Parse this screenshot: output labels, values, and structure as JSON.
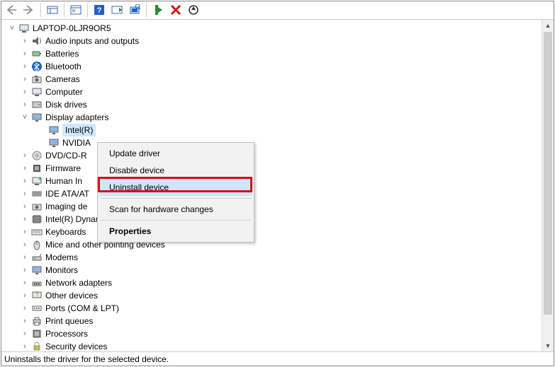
{
  "root": {
    "label": "LAPTOP-0LJR9OR5"
  },
  "categories": [
    {
      "id": "audio",
      "label": "Audio inputs and outputs",
      "exp": ">"
    },
    {
      "id": "batt",
      "label": "Batteries",
      "exp": ">"
    },
    {
      "id": "bt",
      "label": "Bluetooth",
      "exp": ">"
    },
    {
      "id": "cam",
      "label": "Cameras",
      "exp": ">"
    },
    {
      "id": "comp",
      "label": "Computer",
      "exp": ">"
    },
    {
      "id": "disk",
      "label": "Disk drives",
      "exp": ">"
    },
    {
      "id": "disp",
      "label": "Display adapters",
      "exp": "v",
      "children": [
        {
          "id": "disp-intel",
          "label": "Intel(R)",
          "selected": true
        },
        {
          "id": "disp-nvidia",
          "label": "NVIDIA"
        }
      ]
    },
    {
      "id": "dvd",
      "label": "DVD/CD-R",
      "exp": ">",
      "truncated": true
    },
    {
      "id": "fw",
      "label": "Firmware",
      "exp": ">",
      "truncated": true
    },
    {
      "id": "hid",
      "label": "Human In",
      "exp": ">",
      "truncated": true
    },
    {
      "id": "ide",
      "label": "IDE ATA/AT",
      "exp": ">",
      "truncated": true
    },
    {
      "id": "img",
      "label": "Imaging de",
      "exp": ">",
      "truncated": true
    },
    {
      "id": "dptf",
      "label": "Intel(R) Dynamic Platform and Thermal Framework",
      "exp": ">"
    },
    {
      "id": "kb",
      "label": "Keyboards",
      "exp": ">"
    },
    {
      "id": "mice",
      "label": "Mice and other pointing devices",
      "exp": ">"
    },
    {
      "id": "modem",
      "label": "Modems",
      "exp": ">"
    },
    {
      "id": "mon",
      "label": "Monitors",
      "exp": ">"
    },
    {
      "id": "net",
      "label": "Network adapters",
      "exp": ">"
    },
    {
      "id": "other",
      "label": "Other devices",
      "exp": ">"
    },
    {
      "id": "ports",
      "label": "Ports (COM & LPT)",
      "exp": ">"
    },
    {
      "id": "print",
      "label": "Print queues",
      "exp": ">"
    },
    {
      "id": "proc",
      "label": "Processors",
      "exp": ">"
    },
    {
      "id": "sec",
      "label": "Security devices",
      "exp": ">"
    }
  ],
  "context_menu": {
    "items": [
      {
        "label": "Update driver"
      },
      {
        "label": "Disable device"
      },
      {
        "label": "Uninstall device",
        "highlight": true,
        "hover": true
      },
      "sep",
      {
        "label": "Scan for hardware changes"
      },
      "sep",
      {
        "label": "Properties",
        "bold": true
      }
    ]
  },
  "status_bar": "Uninstalls the driver for the selected device.",
  "icons": {
    "computer": "🖥",
    "audio": "🔊",
    "battery": "🔋",
    "bt": "ᛒ",
    "camera": "📷",
    "disk": "🖴",
    "display": "🖵",
    "dvd": "💿",
    "fw": "▤",
    "hid": "🖐",
    "ide": "≣",
    "img": "📸",
    "chip": "▦",
    "kb": "⌨",
    "mouse": "🖱",
    "modem": "☎",
    "net": "🖧",
    "other": "⚙",
    "ports": "⎘",
    "print": "🖶",
    "sec": "🔒"
  }
}
